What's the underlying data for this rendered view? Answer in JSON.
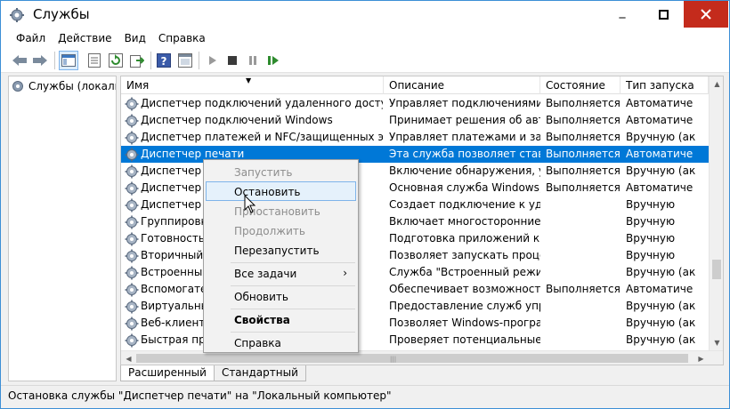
{
  "window": {
    "title": "Службы",
    "minimize_glyph": "_",
    "accent": "#0078d7"
  },
  "menubar": {
    "items": [
      "Файл",
      "Действие",
      "Вид",
      "Справка"
    ]
  },
  "toolbar": {
    "icons": [
      "back-arrow-icon",
      "forward-arrow-icon",
      "console-tree-icon",
      "properties-icon",
      "refresh-icon",
      "export-icon",
      "help-icon",
      "view-icon",
      "play-icon",
      "stop-icon",
      "pause-icon",
      "restart-icon"
    ]
  },
  "tree": {
    "root_label": "Службы (локалы"
  },
  "list": {
    "columns": {
      "name": "Имя",
      "desc": "Описание",
      "state": "Состояние",
      "start": "Тип запуска"
    },
    "rows": [
      {
        "name": "Диспетчер подключений удаленного доступа",
        "desc": "Управляет подключениями к",
        "state": "Выполняется",
        "start": "Автоматиче"
      },
      {
        "name": "Диспетчер подключений Windows",
        "desc": "Принимает решения об авт",
        "state": "Выполняется",
        "start": "Автоматиче"
      },
      {
        "name": "Диспетчер платежей и NFC/защищенных элем...",
        "desc": "Управляет платежами и за",
        "state": "Выполняется",
        "start": "Вручную (ак"
      },
      {
        "name": "Диспетчер печати",
        "desc": "Эта служба позволяет стави",
        "state": "Выполняется",
        "start": "Автоматиче"
      },
      {
        "name": "Диспетчер пол",
        "desc": "Включение обнаружения, у",
        "state": "Выполняется",
        "start": "Вручную (ак"
      },
      {
        "name": "Диспетчер л",
        "desc": "Основная служба Windows,",
        "state": "Выполняется",
        "start": "Автоматиче"
      },
      {
        "name": "Диспетчер а",
        "desc": "Создает подключение к уда",
        "state": "",
        "start": "Вручную"
      },
      {
        "name": "Группировка",
        "desc": "Включает многосторонние",
        "state": "",
        "start": "Вручную"
      },
      {
        "name": "Готовность п",
        "desc": "Подготовка приложений к",
        "state": "",
        "start": "Вручную"
      },
      {
        "name": "Вторичный в",
        "desc": "Позволяет запускать проце",
        "state": "",
        "start": "Вручную"
      },
      {
        "name": "Встроенный",
        "desc": "Служба \"Встроенный режи",
        "state": "",
        "start": "Вручную (ак"
      },
      {
        "name": "Вспомогате",
        "desc": "Обеспечивает возможность",
        "state": "Выполняется",
        "start": "Автоматиче"
      },
      {
        "name": "Виртуальны",
        "desc": "Предоставление служб упр",
        "state": "",
        "start": "Вручную (ак"
      },
      {
        "name": "Веб-клиент",
        "desc": "Позволяет Windows-програ",
        "state": "",
        "start": "Вручную (ак"
      },
      {
        "name": "Быстрая про",
        "desc": "Проверяет потенциальные",
        "state": "",
        "start": "Вручную (ак"
      }
    ],
    "selected_index": 3
  },
  "context_menu": {
    "items": [
      {
        "label": "Запустить",
        "disabled": true
      },
      {
        "label": "Остановить",
        "disabled": false,
        "hover": true
      },
      {
        "label": "Приостановить",
        "disabled": true
      },
      {
        "label": "Продолжить",
        "disabled": true
      },
      {
        "label": "Перезапустить",
        "disabled": false
      },
      {
        "label": "Все задачи",
        "disabled": false,
        "submenu": true
      },
      {
        "label": "Обновить",
        "disabled": false
      },
      {
        "label": "Свойства",
        "disabled": false,
        "bold": true
      },
      {
        "label": "Справка",
        "disabled": false
      }
    ],
    "submenu_arrow": "›"
  },
  "tabs": {
    "extended": "Расширенный",
    "standard": "Стандартный"
  },
  "statusbar": {
    "text": "Остановка службы \"Диспетчер печати\" на \"Локальный компьютер\""
  }
}
